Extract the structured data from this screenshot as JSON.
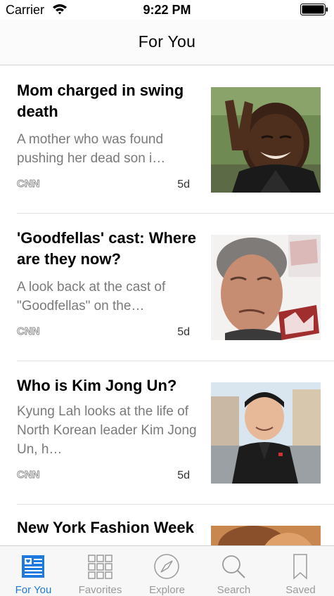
{
  "status_bar": {
    "carrier": "Carrier",
    "time": "9:22 PM"
  },
  "nav": {
    "title": "For You"
  },
  "stories": [
    {
      "headline": "Mom charged in swing death",
      "summary": "A mother who was found pushing her dead son i…",
      "source": "CNN",
      "age": "5d",
      "image": "boy-peace-sign-photo"
    },
    {
      "headline": "'Goodfellas' cast: Where are they now?",
      "summary": "A look back at the cast of \"Goodfellas\" on the…",
      "source": "CNN",
      "age": "5d",
      "image": "ray-liotta-photo"
    },
    {
      "headline": "Who is Kim Jong Un?",
      "summary": "Kyung Lah looks at the life of North Korean leader Kim Jong Un, h…",
      "source": "CNN",
      "age": "5d",
      "image": "kim-jong-un-photo"
    },
    {
      "headline": "New York Fashion Week Di…",
      "image": "fashion-week-photo"
    }
  ],
  "tabs": [
    {
      "label": "For You",
      "icon": "news-icon",
      "active": true
    },
    {
      "label": "Favorites",
      "icon": "grid-icon",
      "active": false
    },
    {
      "label": "Explore",
      "icon": "compass-icon",
      "active": false
    },
    {
      "label": "Search",
      "icon": "magnifier-icon",
      "active": false
    },
    {
      "label": "Saved",
      "icon": "bookmark-icon",
      "active": false
    }
  ],
  "colors": {
    "accent": "#1f7ae0",
    "inactive": "#9a9a9a",
    "summary_text": "#7a7a7a"
  }
}
